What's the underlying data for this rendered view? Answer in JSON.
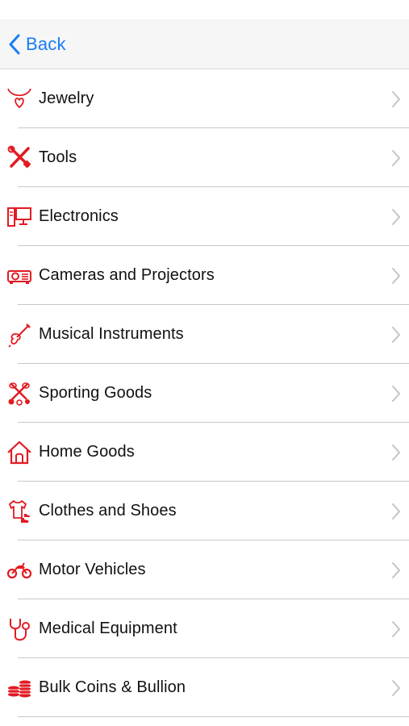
{
  "nav": {
    "back_label": "Back"
  },
  "colors": {
    "accent": "#1a7cf5",
    "icon": "#e21b23",
    "chevron": "#c4c4c8"
  },
  "categories": [
    {
      "label": "Jewelry",
      "icon": "necklace-icon"
    },
    {
      "label": "Tools",
      "icon": "tools-icon"
    },
    {
      "label": "Electronics",
      "icon": "computer-icon"
    },
    {
      "label": "Cameras and Projectors",
      "icon": "projector-icon"
    },
    {
      "label": "Musical Instruments",
      "icon": "guitar-icon"
    },
    {
      "label": "Sporting Goods",
      "icon": "sports-icon"
    },
    {
      "label": "Home Goods",
      "icon": "house-icon"
    },
    {
      "label": "Clothes and Shoes",
      "icon": "shirt-icon"
    },
    {
      "label": "Motor Vehicles",
      "icon": "motorcycle-icon"
    },
    {
      "label": "Medical Equipment",
      "icon": "stethoscope-icon"
    },
    {
      "label": "Bulk Coins & Bullion",
      "icon": "coins-icon"
    }
  ]
}
